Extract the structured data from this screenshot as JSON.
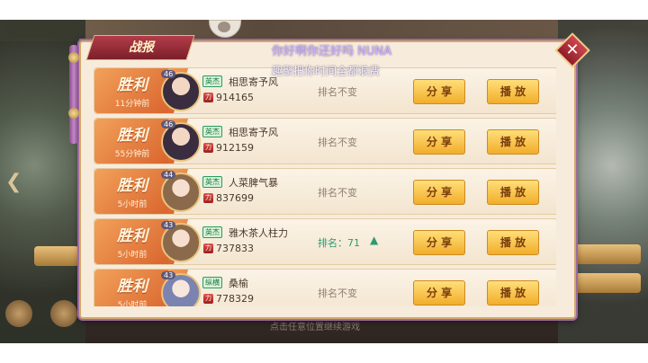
{
  "panel": {
    "title": "战报",
    "close_icon": "close-icon"
  },
  "overlay": {
    "line1": "你好啊你还好吗 NUNA",
    "line2": "趣聚把你时间全都浪费"
  },
  "background": {
    "hint": "点击任意位置继续游戏"
  },
  "reports": [
    {
      "result": "胜利",
      "time": "11分钟前",
      "level": "46",
      "badge": "英杰",
      "name": "相思寄予风",
      "power": "914165",
      "rank": "排名不变",
      "rank_up": false,
      "share": "分 享",
      "play": "播 放",
      "avatar_color": "#3a2d3f"
    },
    {
      "result": "胜利",
      "time": "55分钟前",
      "level": "46",
      "badge": "英杰",
      "name": "相思寄予风",
      "power": "912159",
      "rank": "排名不变",
      "rank_up": false,
      "share": "分 享",
      "play": "播 放",
      "avatar_color": "#3a2d3f"
    },
    {
      "result": "胜利",
      "time": "5小时前",
      "level": "44",
      "badge": "英杰",
      "name": "人菜脾气暴",
      "power": "837699",
      "rank": "排名不变",
      "rank_up": false,
      "share": "分 享",
      "play": "播 放",
      "avatar_color": "#8a6a4a"
    },
    {
      "result": "胜利",
      "time": "5小时前",
      "level": "43",
      "badge": "英杰",
      "name": "雅木茶人柱力",
      "power": "737833",
      "rank": "排名：71",
      "rank_up": true,
      "share": "分 享",
      "play": "播 放",
      "avatar_color": "#8a6a4a"
    },
    {
      "result": "胜利",
      "time": "5小时前",
      "level": "43",
      "badge": "纵横",
      "name": "桑榆",
      "power": "778329",
      "rank": "排名不变",
      "rank_up": false,
      "share": "分 享",
      "play": "播 放",
      "avatar_color": "#7b83b0"
    }
  ],
  "colors": {
    "accent_purple": "#8a4d8f",
    "victory_orange": "#e07a3a",
    "button_gold": "#f6c24f",
    "rank_up_green": "#2b9a72"
  }
}
